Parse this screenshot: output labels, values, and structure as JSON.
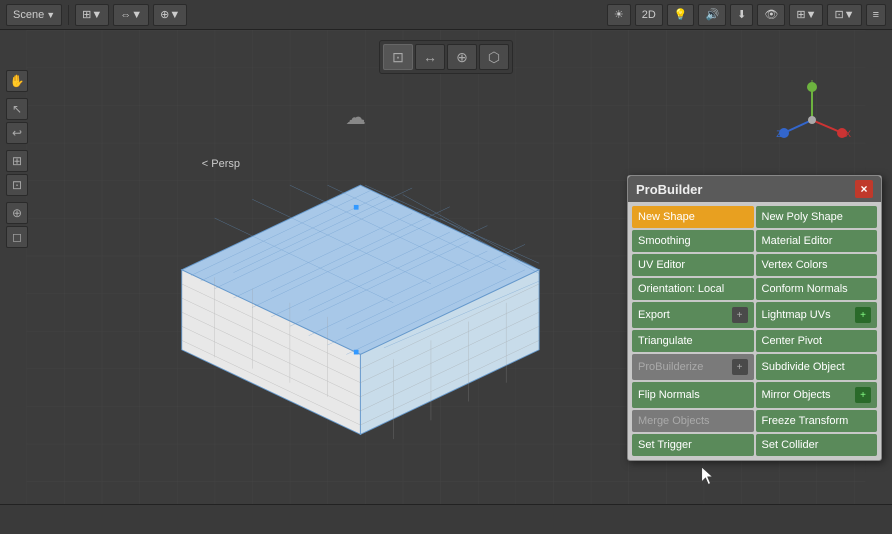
{
  "topToolbar": {
    "leftButtons": [
      {
        "label": "Scene",
        "icon": "≡"
      },
      {
        "label": "▼",
        "icon": ""
      },
      {
        "label": "⊞",
        "icon": ""
      },
      {
        "label": "↕",
        "icon": ""
      },
      {
        "label": "⊕",
        "icon": ""
      },
      {
        "label": "⊗",
        "icon": ""
      }
    ],
    "rightButtons": [
      {
        "label": "☀",
        "icon": ""
      },
      {
        "label": "2D",
        "icon": ""
      },
      {
        "label": "💡",
        "icon": ""
      },
      {
        "label": "🔊",
        "icon": ""
      },
      {
        "label": "⬇",
        "icon": ""
      },
      {
        "label": "👁",
        "icon": ""
      },
      {
        "label": "⊞",
        "icon": ""
      },
      {
        "label": "⊡",
        "icon": ""
      },
      {
        "label": "≡",
        "icon": ""
      }
    ]
  },
  "centerToolbar": {
    "buttons": [
      "⊡",
      "↔",
      "⊕",
      "⬡"
    ]
  },
  "probuilder": {
    "title": "ProBuilder",
    "closeLabel": "×",
    "buttons": [
      {
        "label": "New Shape",
        "type": "active",
        "col": 1,
        "hasPlus": false
      },
      {
        "label": "New Poly Shape",
        "type": "normal",
        "col": 2,
        "hasPlus": false
      },
      {
        "label": "Smoothing",
        "type": "normal",
        "col": 1,
        "hasPlus": false
      },
      {
        "label": "Material Editor",
        "type": "normal",
        "col": 2,
        "hasPlus": false
      },
      {
        "label": "UV Editor",
        "type": "normal",
        "col": 1,
        "hasPlus": false
      },
      {
        "label": "Vertex Colors",
        "type": "normal",
        "col": 2,
        "hasPlus": false
      },
      {
        "label": "Orientation: Local",
        "type": "normal",
        "col": 1,
        "hasPlus": false
      },
      {
        "label": "Conform Normals",
        "type": "normal",
        "col": 2,
        "hasPlus": false
      },
      {
        "label": "Export",
        "type": "normal",
        "col": 1,
        "hasPlus": true,
        "plusStyle": "dark"
      },
      {
        "label": "Lightmap UVs",
        "type": "normal",
        "col": 2,
        "hasPlus": true,
        "plusStyle": "green"
      },
      {
        "label": "Triangulate",
        "type": "normal",
        "col": 1,
        "hasPlus": false
      },
      {
        "label": "Center Pivot",
        "type": "normal",
        "col": 2,
        "hasPlus": false
      },
      {
        "label": "ProBuilderize",
        "type": "disabled",
        "col": 1,
        "hasPlus": true,
        "plusStyle": "dark"
      },
      {
        "label": "Subdivide Object",
        "type": "normal",
        "col": 2,
        "hasPlus": false
      },
      {
        "label": "Flip Normals",
        "type": "normal",
        "col": 1,
        "hasPlus": false
      },
      {
        "label": "Mirror Objects",
        "type": "normal",
        "col": 2,
        "hasPlus": true,
        "plusStyle": "green"
      },
      {
        "label": "Merge Objects",
        "type": "disabled",
        "col": 1,
        "hasPlus": false
      },
      {
        "label": "Freeze Transform",
        "type": "normal",
        "col": 2,
        "hasPlus": false
      },
      {
        "label": "Set Trigger",
        "type": "normal",
        "col": 1,
        "hasPlus": false
      },
      {
        "label": "Set Collider",
        "type": "normal",
        "col": 2,
        "hasPlus": false
      }
    ]
  },
  "perspLabel": "< Persp",
  "statusBar": {
    "text": ""
  },
  "colors": {
    "activeBtn": "#e8a020",
    "normalBtn": "#5a8a5a",
    "disabledBtn": "#7a7a7a",
    "panelBg": "#c8c8c8",
    "headerBg": "#5a5a5a",
    "closeBg": "#c0392b"
  }
}
